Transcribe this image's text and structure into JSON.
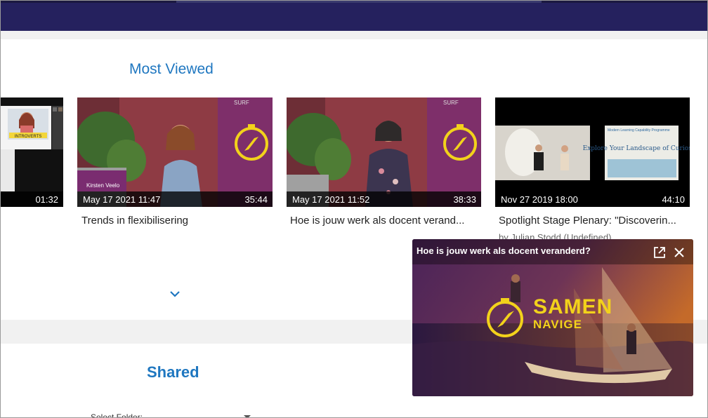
{
  "sections": {
    "most_viewed": "Most Viewed",
    "shared": "Shared"
  },
  "cards": [
    {
      "date": "",
      "duration": "01:32",
      "title": "",
      "subtitle": ""
    },
    {
      "date": "May 17 2021 11:47",
      "duration": "35:44",
      "title": "Trends in flexibilisering",
      "subtitle": "",
      "caption_name": "Kirsten Veelo"
    },
    {
      "date": "May 17 2021 11:52",
      "duration": "38:33",
      "title": "Hoe is jouw werk als docent verand...",
      "subtitle": ""
    },
    {
      "date": "Nov 27 2019 18:00",
      "duration": "44:10",
      "title": "Spotlight Stage Plenary: \"Discoverin...",
      "subtitle": "by Julian Stodd (Undefined)",
      "slide_text": "Explore Your Landscape of Curiosity",
      "slide_header": "Modern Learning Capability Programme"
    }
  ],
  "thumb_badges": {
    "surf": "SURF",
    "introverts": "INTROVERTS"
  },
  "select_folder": {
    "label": "Select Folder:"
  },
  "player": {
    "title": "Hoe is jouw werk als docent veranderd?",
    "brand_line1": "SAMEN",
    "brand_line2": "NAVIGE",
    "icons": [
      "external-link-icon",
      "close-icon"
    ]
  },
  "colors": {
    "topbar": "#25215e",
    "section_title": "#1f77c0",
    "brand_yellow": "#f2d21b"
  }
}
